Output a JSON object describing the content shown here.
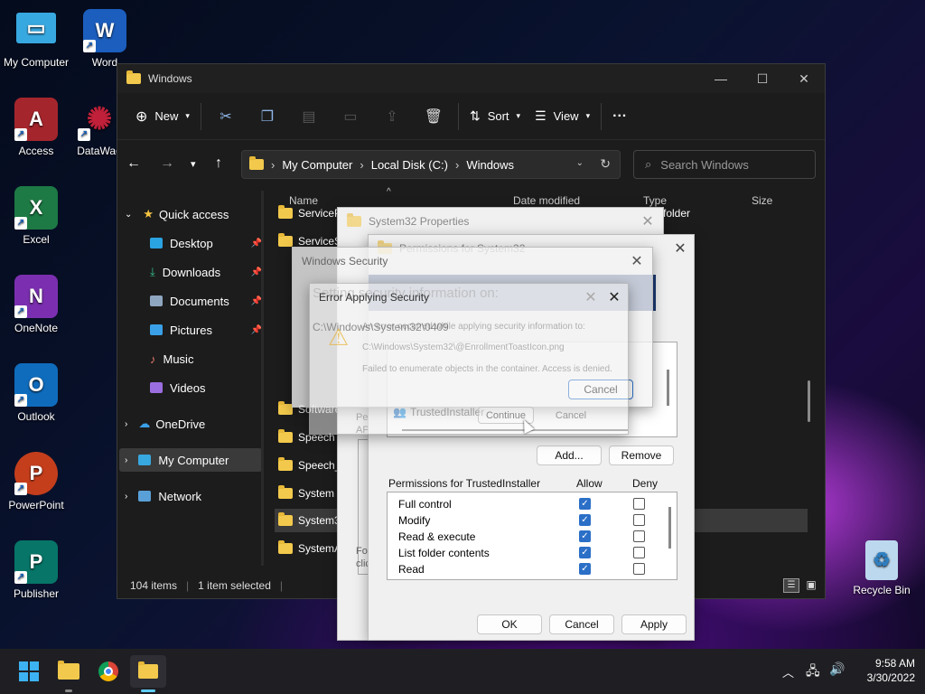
{
  "desktop": {
    "icons": [
      {
        "label": "My Computer",
        "color": "#38a8e0",
        "glyph": "▭"
      },
      {
        "label": "Word",
        "color": "#1b5ebe",
        "glyph": "W"
      },
      {
        "label": "Access",
        "color": "#a4262c",
        "glyph": "A"
      },
      {
        "label": "DataWag",
        "color": "#8a1020",
        "glyph": "✺"
      },
      {
        "label": "Excel",
        "color": "#1d7a45",
        "glyph": "X"
      },
      {
        "label": "OneNote",
        "color": "#7b2fb0",
        "glyph": "N"
      },
      {
        "label": "Outlook",
        "color": "#0f6cbd",
        "glyph": "O"
      },
      {
        "label": "PowerPoint",
        "color": "#c43e1c",
        "glyph": "P"
      },
      {
        "label": "Publisher",
        "color": "#077568",
        "glyph": "P"
      },
      {
        "label": "Recycle Bin",
        "color": "#6aa6d6",
        "glyph": "♻"
      }
    ]
  },
  "explorer": {
    "title": "Windows",
    "toolbar": {
      "new": "New",
      "sort": "Sort",
      "view": "View",
      "more": "···"
    },
    "address": {
      "crumbs": [
        "My Computer",
        "Local Disk (C:)",
        "Windows"
      ]
    },
    "search_placeholder": "Search Windows",
    "nav": {
      "quick_access": "Quick access",
      "items": [
        "Desktop",
        "Downloads",
        "Documents",
        "Pictures",
        "Music",
        "Videos"
      ],
      "onedrive": "OneDrive",
      "mycomputer": "My Computer",
      "network": "Network"
    },
    "columns": {
      "name": "Name",
      "date": "Date modified",
      "type": "Type",
      "size": "Size"
    },
    "type_partial": "folder",
    "files": [
      "ServiceP",
      "ServiceSt",
      "Software",
      "Speech",
      "Speech_O",
      "System",
      "System32",
      "SystemA"
    ],
    "status": {
      "count": "104 items",
      "selected": "1 item selected"
    }
  },
  "props": {
    "title": "System32 Properties",
    "perm_title": "Permissions for System32",
    "pe": "Pe",
    "ap": "AP",
    "for": "For",
    "cli": "clic",
    "owner": "TrustedInstaller",
    "add": "Add...",
    "remove": "Remove",
    "perm_for": "Permissions for TrustedInstaller",
    "allow": "Allow",
    "deny": "Deny",
    "perms": [
      "Full control",
      "Modify",
      "Read & execute",
      "List folder contents",
      "Read"
    ],
    "ok": "OK",
    "cancel": "Cancel",
    "apply": "Apply"
  },
  "security": {
    "title": "Windows Security",
    "heading": "Setting security information on:",
    "path": "C:\\Windows\\System32\\0409",
    "cancel": "Cancel"
  },
  "error": {
    "title": "Error Applying Security",
    "line1": "An error occurred while applying security information to:",
    "line2": "C:\\Windows\\System32\\@EnrollmentToastIcon.png",
    "line3": "Failed to enumerate objects in the container. Access is denied.",
    "continue": "Continue",
    "cancel": "Cancel"
  },
  "taskbar": {
    "time": "9:58 AM",
    "date": "3/30/2022"
  }
}
